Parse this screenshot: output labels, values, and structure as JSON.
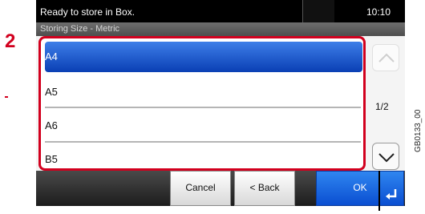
{
  "status": {
    "message": "Ready to store in Box.",
    "time": "10:10"
  },
  "subtitle": "Storing Size - Metric",
  "step_marker": "2",
  "list": {
    "items": [
      {
        "label": "A4",
        "selected": true
      },
      {
        "label": "A5",
        "selected": false
      },
      {
        "label": "A6",
        "selected": false
      },
      {
        "label": "B5",
        "selected": false
      }
    ]
  },
  "pagination": {
    "indicator": "1/2"
  },
  "buttons": {
    "cancel": "Cancel",
    "back": "< Back",
    "ok": "OK"
  },
  "figure_code": "GB0133_00",
  "colors": {
    "highlight": "#d2001e",
    "selected": "#1656d6",
    "ok_button": "#1a6be6"
  },
  "icons": {
    "scroll_up": "chevron-up-icon",
    "scroll_down": "chevron-down-icon",
    "enter": "enter-icon"
  }
}
